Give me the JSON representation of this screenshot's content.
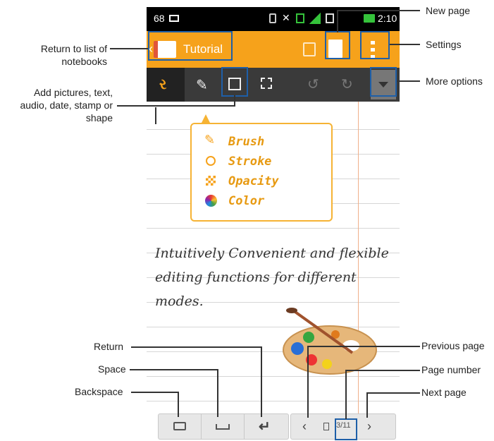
{
  "statusbar": {
    "left_number": "68",
    "time": "2:10"
  },
  "actionbar": {
    "title": "Tutorial"
  },
  "popup_menu": {
    "items": [
      {
        "label": "Brush",
        "icon": "brush-icon"
      },
      {
        "label": "Stroke",
        "icon": "stroke-circle-icon"
      },
      {
        "label": "Opacity",
        "icon": "opacity-icon"
      },
      {
        "label": "Color",
        "icon": "color-wheel-icon"
      }
    ]
  },
  "handwriting": {
    "line1": "Intuitively Convenient and flexible",
    "line2": "editing functions for different",
    "line3": "modes."
  },
  "page_nav": {
    "page_number": "3/11"
  },
  "annotations": {
    "new_page": "New page",
    "settings": "Settings",
    "more_options": "More options",
    "return_list_1": "Return to list of",
    "return_list_2": "notebooks",
    "add_content_1": "Add pictures, text,",
    "add_content_2": "audio, date, stamp or",
    "add_content_3": "shape",
    "return": "Return",
    "space": "Space",
    "backspace": "Backspace",
    "previous_page": "Previous page",
    "page_number": "Page number",
    "next_page": "Next page"
  },
  "colors": {
    "actionbar": "#f6a21b",
    "highlight": "#1e5fa8",
    "toolbar": "#3a3a3a"
  }
}
